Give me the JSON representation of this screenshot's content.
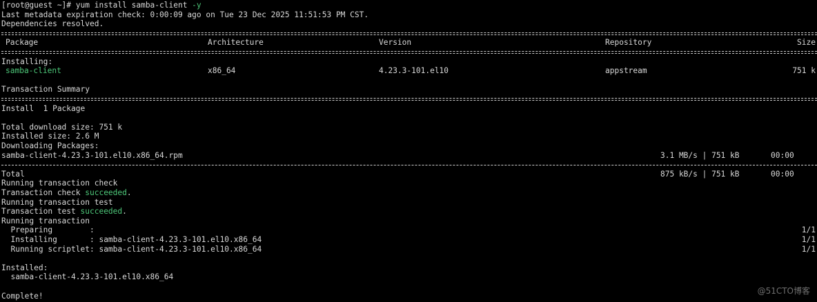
{
  "prompt": "[root@guest ~]# ",
  "command_main": "yum install samba-client",
  "command_flag": " -y",
  "meta_line": "Last metadata expiration check: 0:00:09 ago on Tue 23 Dec 2025 11:51:53 PM CST.",
  "deps_line": "Dependencies resolved.",
  "table": {
    "headers": {
      "package": "Package",
      "architecture": "Architecture",
      "version": "Version",
      "repository": "Repository",
      "size": "Size"
    },
    "section": "Installing:",
    "row": {
      "package": "samba-client",
      "architecture": "x86_64",
      "version": "4.23.3-101.el10",
      "repository": "appstream",
      "size": "751 k"
    }
  },
  "summary_title": "Transaction Summary",
  "install_count": "Install  1 Package",
  "total_download": "Total download size: 751 k",
  "installed_size": "Installed size: 2.6 M",
  "downloading": "Downloading Packages:",
  "download_row": {
    "file": "samba-client-4.23.3-101.el10.x86_64.rpm",
    "rate": "3.1 MB/s | 751 kB",
    "time": "00:00"
  },
  "total_row": {
    "label": "Total",
    "rate": "875 kB/s | 751 kB",
    "time": "00:00"
  },
  "running_check": "Running transaction check",
  "check_prefix": "Transaction check ",
  "test_prefix": "Transaction test ",
  "succeeded": "succeeded",
  "period": ".",
  "running_test": "Running transaction test",
  "running_tx": "Running transaction",
  "steps": [
    {
      "label": "  Preparing        :",
      "value": "",
      "count": "1/1"
    },
    {
      "label": "  Installing       : ",
      "value": "samba-client-4.23.3-101.el10.x86_64",
      "count": "1/1"
    },
    {
      "label": "  Running scriptlet: ",
      "value": "samba-client-4.23.3-101.el10.x86_64",
      "count": "1/1"
    }
  ],
  "installed_title": "Installed:",
  "installed_pkg": "  samba-client-4.23.3-101.el10.x86_64",
  "complete": "Complete!",
  "watermark": "@51CTO博客",
  "colors": {
    "background": "#000000",
    "text": "#d9d9d9",
    "success": "#4ec97a"
  }
}
